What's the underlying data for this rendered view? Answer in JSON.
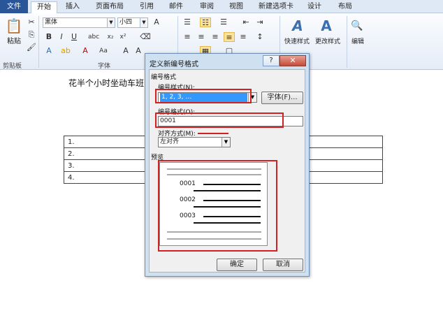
{
  "tabs": [
    "文件",
    "开始",
    "插入",
    "页面布局",
    "引用",
    "邮件",
    "审阅",
    "视图",
    "新建选项卡",
    "设计",
    "布局"
  ],
  "ribbon": {
    "paste_label": "粘贴",
    "clipboard_label": "剪贴板",
    "font_group_label": "字体",
    "font_name": "黑体",
    "font_size": "小四",
    "bold": "B",
    "italic": "I",
    "underline": "U",
    "styles_quick_label": "快速样式",
    "styles_change_label": "更改样式",
    "edit_label": "编辑"
  },
  "document": {
    "text_line": "花半个小时坐动车班",
    "table_rows": [
      "1.",
      "2.",
      "3.",
      "4."
    ]
  },
  "dialog": {
    "title": "定义新编号格式",
    "help": "?",
    "close": "✕",
    "section_number_format": "编号格式",
    "number_style_label": "编号样式(N):",
    "number_style_value": "1, 2, 3, …",
    "font_button": "字体(F)...",
    "number_format_label": "编号格式(O):",
    "number_format_value": "0001",
    "alignment_label": "对齐方式(M):",
    "alignment_value": "左对齐",
    "preview_label": "预览",
    "preview_numbers": [
      "0001",
      "0002",
      "0003"
    ],
    "ok": "确定",
    "cancel": "取消"
  },
  "colors": {
    "highlight_red": "#d42020",
    "selection_blue": "#3399ff",
    "file_tab": "#2a5699"
  }
}
